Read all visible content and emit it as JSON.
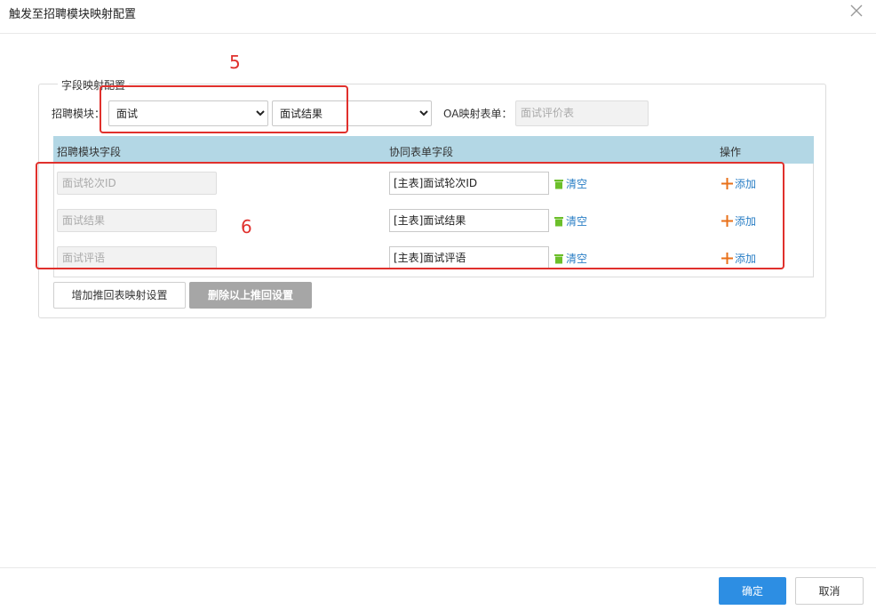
{
  "dialog": {
    "title": "触发至招聘模块映射配置"
  },
  "fieldset": {
    "legend": "字段映射配置"
  },
  "filter": {
    "module_label": "招聘模块：",
    "module_value": "面试",
    "sub_value": "面试结果",
    "oa_label": "OA映射表单：",
    "oa_placeholder": "面试评价表"
  },
  "table": {
    "headers": {
      "col1": "招聘模块字段",
      "col2": "协同表单字段",
      "col3": "操作"
    },
    "rows": [
      {
        "module_field": "面试轮次ID",
        "form_field": "[主表]面试轮次ID",
        "clear": "清空",
        "add": "添加"
      },
      {
        "module_field": "面试结果",
        "form_field": "[主表]面试结果",
        "clear": "清空",
        "add": "添加"
      },
      {
        "module_field": "面试评语",
        "form_field": "[主表]面试评语",
        "clear": "清空",
        "add": "添加"
      }
    ]
  },
  "actions": {
    "add_setting": "增加推回表映射设置",
    "delete_setting": "删除以上推回设置"
  },
  "annotations": {
    "a5": "5",
    "a6": "6"
  },
  "footer": {
    "ok": "确定",
    "cancel": "取消"
  },
  "colors": {
    "accent": "#2d8ee3",
    "header_bg": "#b3d7e5",
    "annotation": "#e0302c",
    "trash": "#6cbf2a",
    "plus": "#e8701a"
  }
}
